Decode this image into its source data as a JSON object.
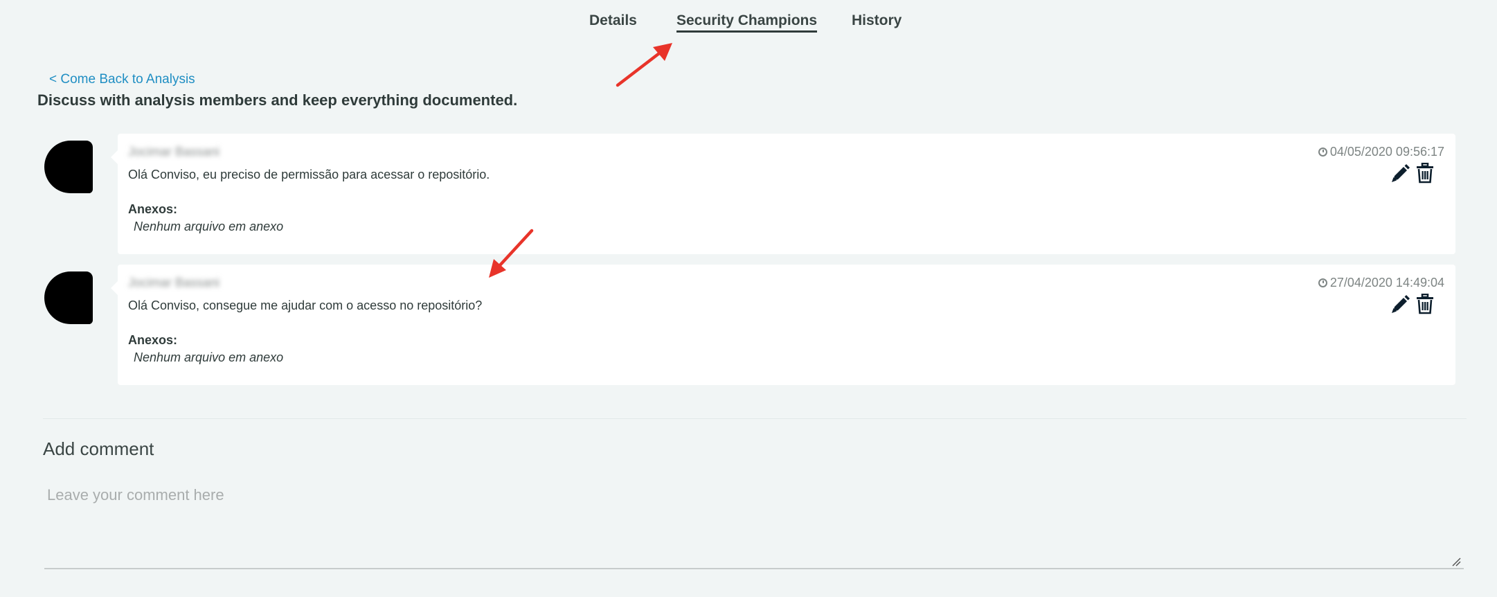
{
  "tabs": [
    {
      "label": "Details",
      "active": false
    },
    {
      "label": "Security Champions",
      "active": true
    },
    {
      "label": "History",
      "active": false
    }
  ],
  "back_link": "< Come Back to Analysis",
  "page_title": "Discuss with analysis members and keep everything documented.",
  "comments": [
    {
      "author": "Jocimar Bassani",
      "timestamp": "04/05/2020 09:56:17",
      "message": "Olá Conviso, eu preciso de permissão para acessar o repositório.",
      "attachments_label": "Anexos:",
      "attachments_empty": "Nenhum arquivo em anexo"
    },
    {
      "author": "Jocimar Bassani",
      "timestamp": "27/04/2020 14:49:04",
      "message": "Olá Conviso, consegue me ajudar com o acesso no repositório?",
      "attachments_label": "Anexos:",
      "attachments_empty": "Nenhum arquivo em anexo"
    }
  ],
  "add_comment": {
    "title": "Add comment",
    "placeholder": "Leave your comment here",
    "value": ""
  },
  "colors": {
    "background": "#f1f5f5",
    "link": "#1f8ec3",
    "text": "#2f3b3a",
    "annotation_arrow": "#e8342a",
    "icon": "#0d1f2d"
  },
  "icons": {
    "edit": "pencil-icon",
    "delete": "trash-icon",
    "time": "clock-icon"
  }
}
